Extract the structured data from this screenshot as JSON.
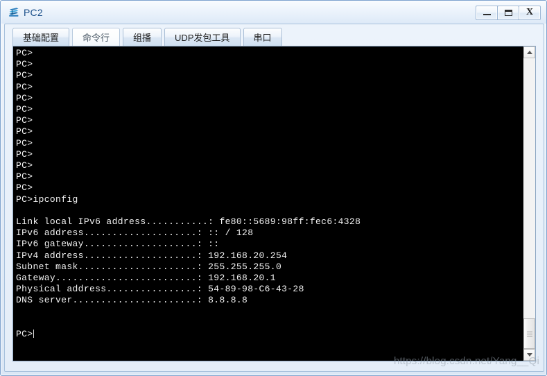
{
  "window": {
    "title": "PC2",
    "icon": "pc-device-icon",
    "accent_color": "#1a4f8a",
    "frame_color": "#7da2ce",
    "controls": [
      {
        "name": "minimize",
        "glyph": "—"
      },
      {
        "name": "maximize",
        "glyph": "□"
      },
      {
        "name": "close",
        "glyph": "X"
      }
    ]
  },
  "tabs": [
    {
      "label": "基础配置",
      "active": false
    },
    {
      "label": "命令行",
      "active": true
    },
    {
      "label": "组播",
      "active": false
    },
    {
      "label": "UDP发包工具",
      "active": false
    },
    {
      "label": "串口",
      "active": false
    }
  ],
  "terminal": {
    "background_color": "#000000",
    "text_color": "#f2f2f2",
    "prompt": "PC>",
    "command": "ipconfig",
    "lines": [
      "PC>",
      "PC>",
      "PC>",
      "PC>",
      "PC>",
      "PC>",
      "PC>",
      "PC>",
      "PC>",
      "PC>",
      "PC>",
      "PC>",
      "PC>",
      "PC>ipconfig",
      "",
      "Link local IPv6 address...........: fe80::5689:98ff:fec6:4328",
      "IPv6 address....................: :: / 128",
      "IPv6 gateway....................: ::",
      "IPv4 address....................: 192.168.20.254",
      "Subnet mask.....................: 255.255.255.0",
      "Gateway.........................: 192.168.20.1",
      "Physical address................: 54-89-98-C6-43-28",
      "DNS server......................: 8.8.8.8",
      "",
      ""
    ],
    "last_prompt": "PC>",
    "ipconfig": {
      "link_local_ipv6_address": "fe80::5689:98ff:fec6:4328",
      "ipv6_address": ":: / 128",
      "ipv6_gateway": "::",
      "ipv4_address": "192.168.20.254",
      "subnet_mask": "255.255.255.0",
      "gateway": "192.168.20.1",
      "physical_address": "54-89-98-C6-43-28",
      "dns_server": "8.8.8.8"
    }
  },
  "scrollbar": {
    "up_arrow": "▲",
    "down_arrow": "▼",
    "thumb_position": "bottom"
  },
  "watermark": {
    "text": "https://blog.csdn.net/Yang__Qi"
  }
}
